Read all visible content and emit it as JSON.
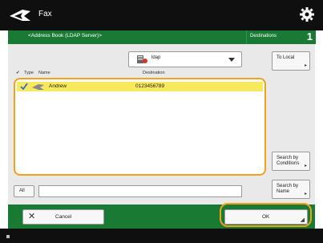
{
  "app": {
    "title": "Fax",
    "icon": "fax-plane-icon",
    "settings_icon": "gear-icon"
  },
  "address_book": {
    "title": "<Address Book (LDAP Server)>"
  },
  "destinations": {
    "label": "Destinations",
    "count": "1"
  },
  "filter": {
    "icon": "ldap-server-icon",
    "selected": "ldap"
  },
  "side_buttons": {
    "to_local": "To Local",
    "search_conditions": "Search by\nConditions",
    "search_name": "Search by\nName"
  },
  "table": {
    "headers": {
      "type": "Type",
      "name": "Name",
      "destination": "Destination"
    },
    "rows": [
      {
        "checked": true,
        "type_icon": "fax-icon",
        "name": "Andrew",
        "destination": "0123456789"
      }
    ]
  },
  "search": {
    "all_label": "All",
    "value": ""
  },
  "footer_actions": {
    "cancel_label": "Cancel",
    "ok_label": "OK"
  },
  "colors": {
    "green": "#197a34",
    "highlight": "#f8e85b",
    "accent": "#f3a11b",
    "topbar": "#0f0f0f"
  }
}
